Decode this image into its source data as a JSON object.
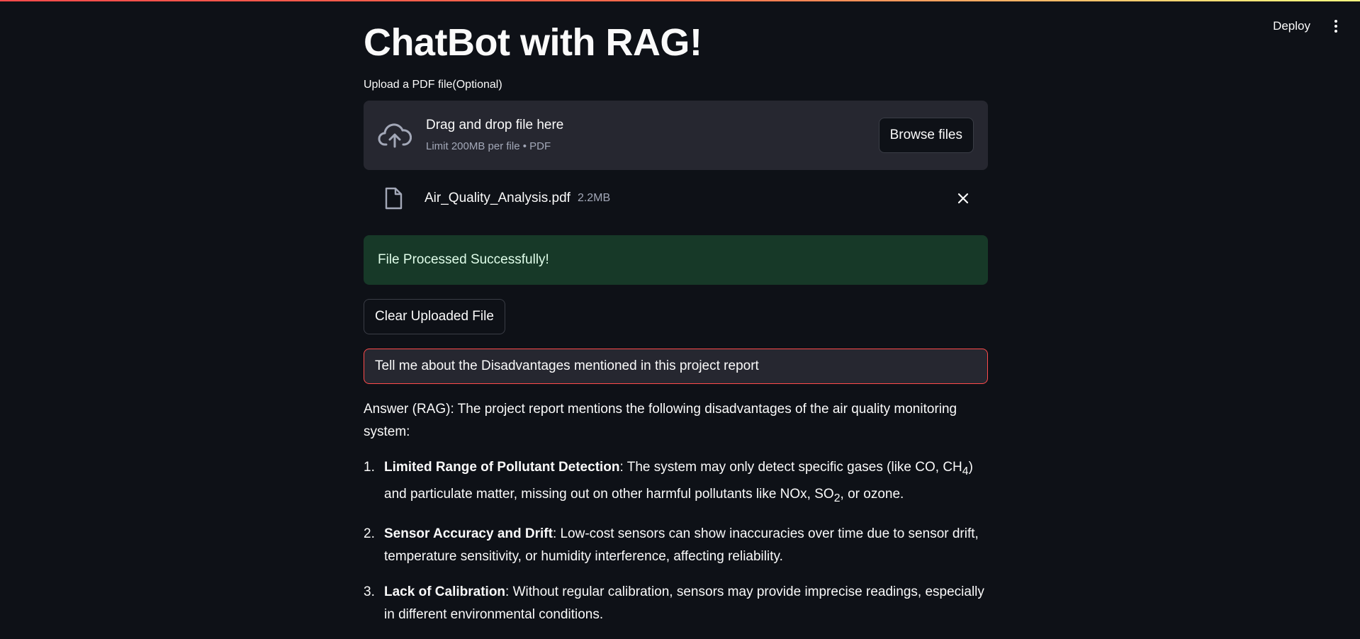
{
  "header": {
    "deploy_label": "Deploy",
    "menu_icon": "kebab-menu-icon"
  },
  "main": {
    "title": "ChatBot with RAG!",
    "uploader": {
      "label": "Upload a PDF file(Optional)",
      "drop_text": "Drag and drop file here",
      "limit_text": "Limit 200MB per file • PDF",
      "browse_label": "Browse files",
      "icon": "cloud-upload-icon"
    },
    "uploaded_file": {
      "name": "Air_Quality_Analysis.pdf",
      "size": "2.2MB",
      "icon": "file-icon",
      "remove_icon": "close-icon"
    },
    "success_message": "File Processed Successfully!",
    "clear_button": "Clear Uploaded File",
    "query": {
      "value": "Tell me about the Disadvantages mentioned in this project report"
    },
    "answer": {
      "intro": "Answer (RAG): The project report mentions the following disadvantages of the air quality monitoring system:",
      "points": [
        {
          "number": "1.",
          "heading": "Limited Range of Pollutant Detection",
          "text_a": ": The system may only detect specific gases (like CO, CH",
          "sub_a": "4",
          "text_b": ") and particulate matter, missing out on other harmful pollutants like NOx, SO",
          "sub_b": "2",
          "text_c": ", or ozone."
        },
        {
          "number": "2.",
          "heading": "Sensor Accuracy and Drift",
          "text": ": Low-cost sensors can show inaccuracies over time due to sensor drift, temperature sensitivity, or humidity interference, affecting reliability."
        },
        {
          "number": "3.",
          "heading": "Lack of Calibration",
          "text": ": Without regular calibration, sensors may provide imprecise readings, especially in different environmental conditions."
        }
      ]
    }
  },
  "colors": {
    "background": "#0e1117",
    "accent": "#ff4b4b",
    "success_bg": "#173928",
    "widget_bg": "#262730"
  }
}
